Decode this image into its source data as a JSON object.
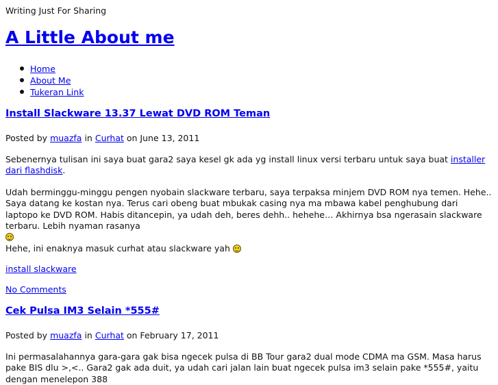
{
  "site": {
    "tagline": "Writing Just For Sharing",
    "title": "A Little About me"
  },
  "nav": {
    "items": [
      {
        "label": "Home"
      },
      {
        "label": "About Me"
      },
      {
        "label": "Tukeran Link"
      }
    ]
  },
  "posts": [
    {
      "title": "Install Slackware 13.37 Lewat DVD ROM Teman",
      "meta": {
        "posted_by": "Posted by",
        "author": "muazfa",
        "in": "in",
        "category": "Curhat",
        "on": "on June 13, 2011"
      },
      "p1_text": "Sebenernya tulisan ini saya buat gara2 saya kesel gk ada yg install linux versi terbaru untuk saya buat ",
      "p1_link": "installer dari flashdisk",
      "p1_end": ".",
      "p2_text": "Udah berminggu-minggu pengen nyobain slackware terbaru, saya terpaksa minjem DVD ROM nya temen. Hehe.. Saya datang ke kostan nya. Terus cari obeng buat mbukak casing nya ma mbawa kabel penghubung dari laptopo ke DVD ROM. Habis ditancepin, ya udah deh, beres dehh.. hehehe… Akhirnya bsa ngerasain slackware terbaru. Lebih nyaman rasanya",
      "p3_text": "Hehe, ini enaknya masuk curhat atau slackware yah",
      "tag": "install slackware",
      "comments": "No Comments"
    },
    {
      "title": "Cek Pulsa IM3 Selain *555#",
      "meta": {
        "posted_by": "Posted by",
        "author": "muazfa",
        "in": "in",
        "category": "Curhat",
        "on": "on February 17, 2011"
      },
      "p1_text": "Ini permasalahannya gara-gara gak bisa ngecek pulsa di BB Tour gara2 dual mode CDMA ma GSM. Masa harus pake BIS dlu >,<.. Gara2 gak ada duit, ya udah cari jalan lain buat ngecek pulsa im3 selain pake *555#, yaitu dengan menelepon 388"
    }
  ],
  "icons": {
    "smiley": "smiley-icon",
    "grin": "grin-smiley-icon"
  }
}
